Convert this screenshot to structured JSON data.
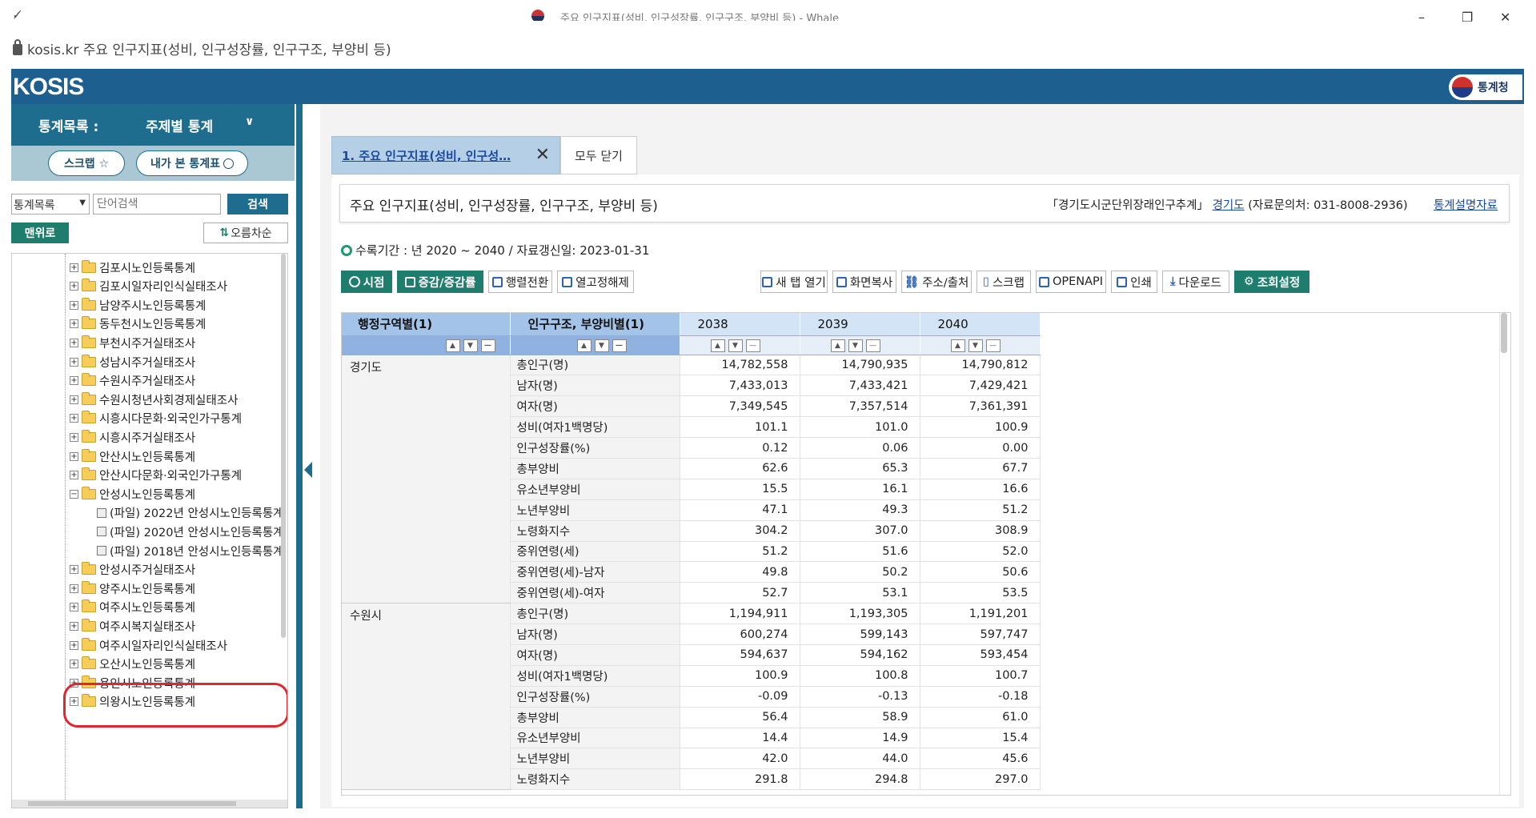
{
  "window": {
    "title": "주요 인구지표(성비, 인구성장률, 인구구조, 부양비 등) - Whale",
    "minimize": "–",
    "maximize": "❐",
    "close": "✕"
  },
  "address": {
    "url": "kosis.kr",
    "page_title": "주요 인구지표(성비, 인구성장률, 인구구조, 부양비 등)"
  },
  "header": {
    "logo": "KOSIS",
    "gov_logo": "통계청"
  },
  "sidebar": {
    "menu_label": "통계목록 :",
    "menu_selected": "주제별 통계",
    "scrap_button": "스크랩 ☆",
    "history_button": "내가 본 통계표",
    "search_type": "통계목록",
    "search_placeholder": "단어검색",
    "search_button": "검색",
    "top_button": "맨위로",
    "sort_button": "오름차순",
    "tree": [
      {
        "label": "김포시노인등록통계",
        "type": "folder",
        "expanded": false
      },
      {
        "label": "김포시일자리인식실태조사",
        "type": "folder",
        "expanded": false
      },
      {
        "label": "남양주시노인등록통계",
        "type": "folder",
        "expanded": false
      },
      {
        "label": "동두천시노인등록통계",
        "type": "folder",
        "expanded": false
      },
      {
        "label": "부천시주거실태조사",
        "type": "folder",
        "expanded": false
      },
      {
        "label": "성남시주거실태조사",
        "type": "folder",
        "expanded": false
      },
      {
        "label": "수원시주거실태조사",
        "type": "folder",
        "expanded": false
      },
      {
        "label": "수원시청년사회경제실태조사",
        "type": "folder",
        "expanded": false
      },
      {
        "label": "시흥시다문화·외국인가구통계",
        "type": "folder",
        "expanded": false
      },
      {
        "label": "시흥시주거실태조사",
        "type": "folder",
        "expanded": false
      },
      {
        "label": "안산시노인등록통계",
        "type": "folder",
        "expanded": false
      },
      {
        "label": "안산시다문화·외국인가구통계",
        "type": "folder",
        "expanded": false
      },
      {
        "label": "안성시노인등록통계",
        "type": "folder",
        "expanded": true
      },
      {
        "label": "(파일) 2022년 안성시노인등록통계",
        "type": "file"
      },
      {
        "label": "(파일) 2020년 안성시노인등록통계",
        "type": "file"
      },
      {
        "label": "(파일) 2018년 안성시노인등록통계",
        "type": "file"
      },
      {
        "label": "안성시주거실태조사",
        "type": "folder",
        "expanded": false
      },
      {
        "label": "양주시노인등록통계",
        "type": "folder",
        "expanded": false
      },
      {
        "label": "여주시노인등록통계",
        "type": "folder",
        "expanded": false
      },
      {
        "label": "여주시복지실태조사",
        "type": "folder",
        "expanded": false
      },
      {
        "label": "여주시일자리인식실태조사",
        "type": "folder",
        "expanded": false
      },
      {
        "label": "오산시노인등록통계",
        "type": "folder",
        "expanded": false
      },
      {
        "label": "용인시노인등록통계",
        "type": "folder",
        "expanded": false
      },
      {
        "label": "의왕시노인등록통계",
        "type": "folder",
        "expanded": false
      }
    ]
  },
  "tabs": {
    "active_label": "1. 주요 인구지표(성비, 인구성…",
    "close_all": "모두 닫기"
  },
  "table_header": {
    "title": "주요 인구지표(성비, 인구성장률, 인구구조, 부양비 등)",
    "source_name": "「경기도시군단위장래인구추계」",
    "source_org": "경기도",
    "contact": "(자료문의처: 031-8008-2936)",
    "doc_link": "통계설명자료"
  },
  "period": {
    "text": "수록기간 : 년 2020 ~ 2040 / 자료갱신일: 2023-01-31"
  },
  "toolbar": {
    "sijeom": "시점",
    "change_rate": "증감/증감률",
    "transpose": "행렬전환",
    "unfix_col": "열고정해제",
    "new_tab": "새 탭 열기",
    "screen_copy": "화면복사",
    "address_source": "주소/출처",
    "scrap": "스크랩",
    "openapi": "OPENAPI",
    "print": "인쇄",
    "download": "다운로드",
    "settings": "조회설정"
  },
  "grid": {
    "col_region": "행정구역별(1)",
    "col_indicator": "인구구조, 부양비별(1)",
    "years": [
      "2038",
      "2039",
      "2040"
    ],
    "groups": [
      {
        "region": "경기도",
        "rows": [
          {
            "indicator": "총인구(명)",
            "values": [
              "14,782,558",
              "14,790,935",
              "14,790,812"
            ]
          },
          {
            "indicator": "남자(명)",
            "values": [
              "7,433,013",
              "7,433,421",
              "7,429,421"
            ]
          },
          {
            "indicator": "여자(명)",
            "values": [
              "7,349,545",
              "7,357,514",
              "7,361,391"
            ]
          },
          {
            "indicator": "성비(여자1백명당)",
            "values": [
              "101.1",
              "101.0",
              "100.9"
            ]
          },
          {
            "indicator": "인구성장률(%)",
            "values": [
              "0.12",
              "0.06",
              "0.00"
            ]
          },
          {
            "indicator": "총부양비",
            "values": [
              "62.6",
              "65.3",
              "67.7"
            ]
          },
          {
            "indicator": "유소년부양비",
            "values": [
              "15.5",
              "16.1",
              "16.6"
            ]
          },
          {
            "indicator": "노년부양비",
            "values": [
              "47.1",
              "49.3",
              "51.2"
            ]
          },
          {
            "indicator": "노령화지수",
            "values": [
              "304.2",
              "307.0",
              "308.9"
            ]
          },
          {
            "indicator": "중위연령(세)",
            "values": [
              "51.2",
              "51.6",
              "52.0"
            ]
          },
          {
            "indicator": "중위연령(세)-남자",
            "values": [
              "49.8",
              "50.2",
              "50.6"
            ]
          },
          {
            "indicator": "중위연령(세)-여자",
            "values": [
              "52.7",
              "53.1",
              "53.5"
            ]
          }
        ]
      },
      {
        "region": "수원시",
        "rows": [
          {
            "indicator": "총인구(명)",
            "values": [
              "1,194,911",
              "1,193,305",
              "1,191,201"
            ]
          },
          {
            "indicator": "남자(명)",
            "values": [
              "600,274",
              "599,143",
              "597,747"
            ]
          },
          {
            "indicator": "여자(명)",
            "values": [
              "594,637",
              "594,162",
              "593,454"
            ]
          },
          {
            "indicator": "성비(여자1백명당)",
            "values": [
              "100.9",
              "100.8",
              "100.7"
            ]
          },
          {
            "indicator": "인구성장률(%)",
            "values": [
              "-0.09",
              "-0.13",
              "-0.18"
            ]
          },
          {
            "indicator": "총부양비",
            "values": [
              "56.4",
              "58.9",
              "61.0"
            ]
          },
          {
            "indicator": "유소년부양비",
            "values": [
              "14.4",
              "14.9",
              "15.4"
            ]
          },
          {
            "indicator": "노년부양비",
            "values": [
              "42.0",
              "44.0",
              "45.6"
            ]
          },
          {
            "indicator": "노령화지수",
            "values": [
              "291.8",
              "294.8",
              "297.0"
            ]
          }
        ]
      }
    ]
  }
}
